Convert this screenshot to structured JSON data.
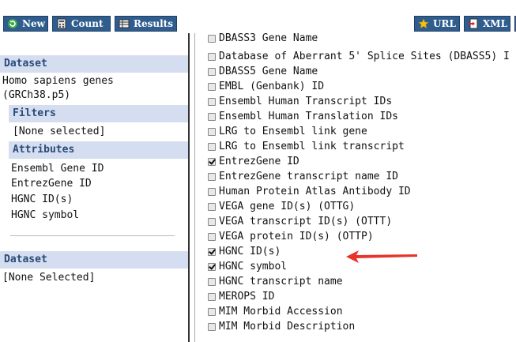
{
  "toolbar": {
    "new_label": "New",
    "count_label": "Count",
    "results_label": "Results",
    "url_label": "URL",
    "xml_label": "XML"
  },
  "left": {
    "dataset_head": "Dataset",
    "dataset_name_line1": "Homo sapiens genes",
    "dataset_name_line2": "(GRCh38.p5)",
    "filters_head": "Filters",
    "filters_value": "[None selected]",
    "attributes_head": "Attributes",
    "attributes": [
      "Ensembl Gene ID",
      "EntrezGene ID",
      "HGNC ID(s)",
      "HGNC symbol"
    ],
    "dataset2_head": "Dataset",
    "dataset2_value": "[None Selected]"
  },
  "attribute_list": [
    {
      "label": "DBASS3 Gene Name",
      "checked": false
    },
    {
      "label": "Database of Aberrant 5' Splice Sites (DBASS5) I",
      "checked": false
    },
    {
      "label": "DBASS5 Gene Name",
      "checked": false
    },
    {
      "label": "EMBL (Genbank) ID",
      "checked": false
    },
    {
      "label": "Ensembl Human Transcript IDs",
      "checked": false
    },
    {
      "label": "Ensembl Human Translation IDs",
      "checked": false
    },
    {
      "label": "LRG to Ensembl link gene",
      "checked": false
    },
    {
      "label": "LRG to Ensembl link transcript",
      "checked": false
    },
    {
      "label": "EntrezGene ID",
      "checked": true
    },
    {
      "label": "EntrezGene transcript name ID",
      "checked": false
    },
    {
      "label": "Human Protein Atlas Antibody ID",
      "checked": false
    },
    {
      "label": "VEGA gene ID(s) (OTTG)",
      "checked": false
    },
    {
      "label": "VEGA transcript ID(s) (OTTT)",
      "checked": false
    },
    {
      "label": "VEGA protein ID(s) (OTTP)",
      "checked": false
    },
    {
      "label": "HGNC ID(s)",
      "checked": true
    },
    {
      "label": "HGNC symbol",
      "checked": true
    },
    {
      "label": "HGNC transcript name",
      "checked": false
    },
    {
      "label": "MEROPS ID",
      "checked": false
    },
    {
      "label": "MIM Morbid Accession",
      "checked": false
    },
    {
      "label": "MIM Morbid Description",
      "checked": false
    }
  ],
  "colors": {
    "button_bg": "#2f5d8e",
    "section_bg": "#d4def0",
    "section_text": "#2a4a78",
    "arrow": "#e8322a"
  }
}
